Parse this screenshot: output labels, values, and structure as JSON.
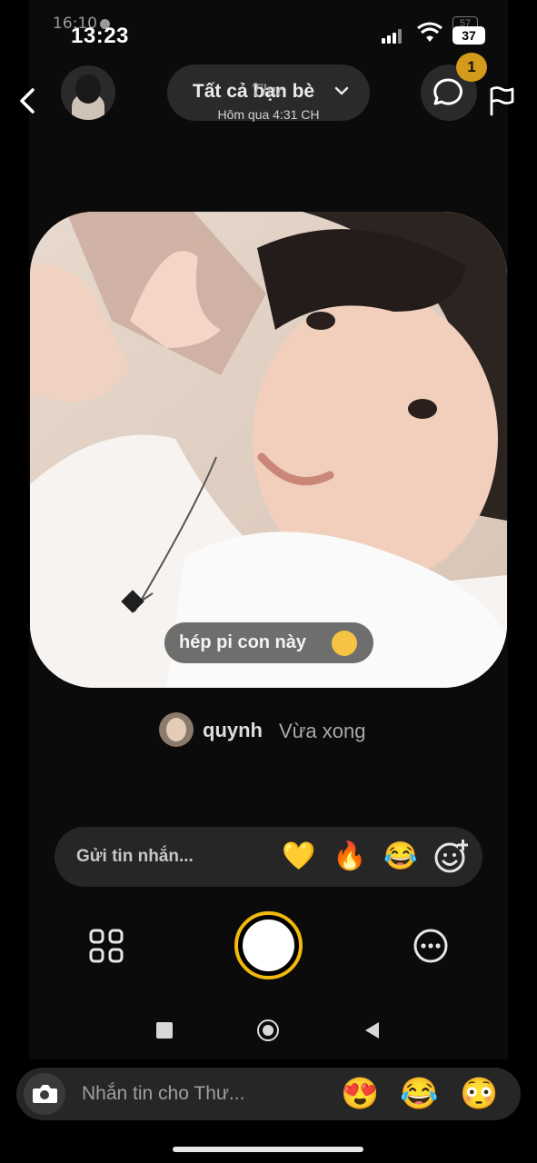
{
  "status_bar": {
    "ghost_time": "16:10",
    "time": "13:23",
    "battery": "37",
    "ghost_battery": "57"
  },
  "header": {
    "audience_label": "Tất cả bạn bè",
    "ghost_name": "Thư",
    "timestamp": "Hôm qua 4:31 CH",
    "chat_badge": "1"
  },
  "post": {
    "caption": "hép pi con này",
    "caption_emoji": "🥳",
    "author": "quynh",
    "posted": "Vừa xong"
  },
  "message_bar": {
    "placeholder": "Gửi tin nhắn...",
    "reactions": [
      "💛",
      "🔥",
      "😂"
    ]
  },
  "dm_bar": {
    "placeholder": "Nhắn tin cho Thư...",
    "emojis": [
      "😍",
      "😂",
      "😳"
    ]
  },
  "icons": {
    "back": "chevron-left-icon",
    "chat": "chat-bubble-icon",
    "flag": "flag-icon",
    "grid": "grid-icon",
    "more": "more-horizontal-icon",
    "camera": "camera-icon",
    "add_reaction": "add-reaction-icon"
  },
  "colors": {
    "accent": "#f0b90b",
    "badge": "#d39a1b",
    "background": "#000000",
    "pill": "#2a2a2a"
  }
}
